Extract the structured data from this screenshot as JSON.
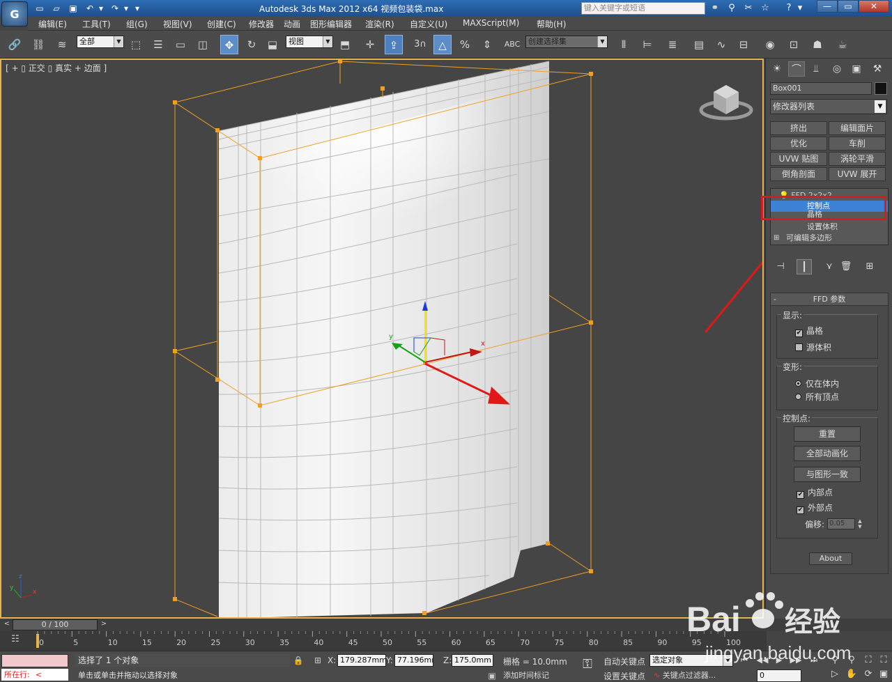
{
  "app": {
    "logo_text": "G",
    "title": "Autodesk 3ds Max  2012 x64      视频包装袋.max",
    "search_placeholder": "键入关键字或短语",
    "quick_access": [
      "▭",
      "▱",
      "▣",
      "↶",
      "▾",
      "↷",
      "▾",
      "▾"
    ],
    "title_icons": [
      "⚭",
      "⚲",
      "✂",
      "☆",
      "?",
      "▾"
    ],
    "window_buttons": [
      "—",
      "▭",
      "✕"
    ]
  },
  "menu": [
    "编辑(E)",
    "工具(T)",
    "组(G)",
    "视图(V)",
    "创建(C)",
    "修改器",
    "动画",
    "图形编辑器",
    "渲染(R)",
    "自定义(U)",
    "MAXScript(M)",
    "帮助(H)"
  ],
  "toolbar": {
    "filter_value": "全部",
    "refcoord_value": "视图",
    "selset_value": "创建选择集",
    "snap_label": "3"
  },
  "viewport": {
    "label": "[ + ▯ 正交 ▯ 真实 + 边面 ]",
    "accent_border": "#e8b44a",
    "lattice_color": "#f0a020",
    "gizmo": {
      "x_label": "x",
      "y_label": "y",
      "z_label": "z"
    },
    "axis_tripod": {
      "x": "x",
      "y": "y",
      "z": "z"
    }
  },
  "command_panel": {
    "object_name": "Box001",
    "modifier_list": "修改器列表",
    "modifier_buttons": [
      "挤出",
      "编辑面片",
      "优化",
      "车削",
      "UVW 贴图",
      "涡轮平滑",
      "倒角剖面",
      "UVW 展开"
    ],
    "stack": {
      "top_item": "FFD 2x2x2",
      "sub_items": [
        "控制点",
        "晶格",
        "设置体积"
      ],
      "base_item": "可编辑多边形"
    },
    "rollout": {
      "title": "FFD 参数",
      "display_group": "显示:",
      "lattice_label": "晶格",
      "source_volume_label": "源体积",
      "deform_group": "变形:",
      "only_in_volume_label": "仅在体内",
      "all_vertices_label": "所有顶点",
      "control_points_group": "控制点:",
      "reset_button": "重置",
      "animate_all_button": "全部动画化",
      "conform_button": "与图形一致",
      "inside_points_label": "内部点",
      "outside_points_label": "外部点",
      "offset_label": "偏移:",
      "offset_value": "0.05",
      "about_button": "About"
    }
  },
  "timeline": {
    "frame_display": "0 / 100",
    "ticks": [
      "0",
      "5",
      "10",
      "15",
      "20",
      "25",
      "30",
      "35",
      "40",
      "45",
      "50",
      "55",
      "60",
      "65",
      "70",
      "75",
      "80",
      "85",
      "90",
      "95",
      "100"
    ]
  },
  "status": {
    "listener_label": "所在行:",
    "selection_text": "选择了 1 个对象",
    "prompt_text": "单击或单击并拖动以选择对象",
    "x_label": "X:",
    "x_value": "179.287mm",
    "y_label": "Y:",
    "y_value": "77.196mm",
    "z_label": "Z:",
    "z_value": "175.0mm",
    "grid_text": "栅格 = 10.0mm",
    "add_time_tag": "添加时间标记",
    "autokey_label": "自动关键点",
    "setkey_label": "设置关键点",
    "selection_combo": "选定对象",
    "key_filters": "关键点过滤器...",
    "frame_value": "0"
  },
  "watermark": {
    "text": "Bai",
    "text2": "经验",
    "url": "jingyan.baidu.com"
  }
}
